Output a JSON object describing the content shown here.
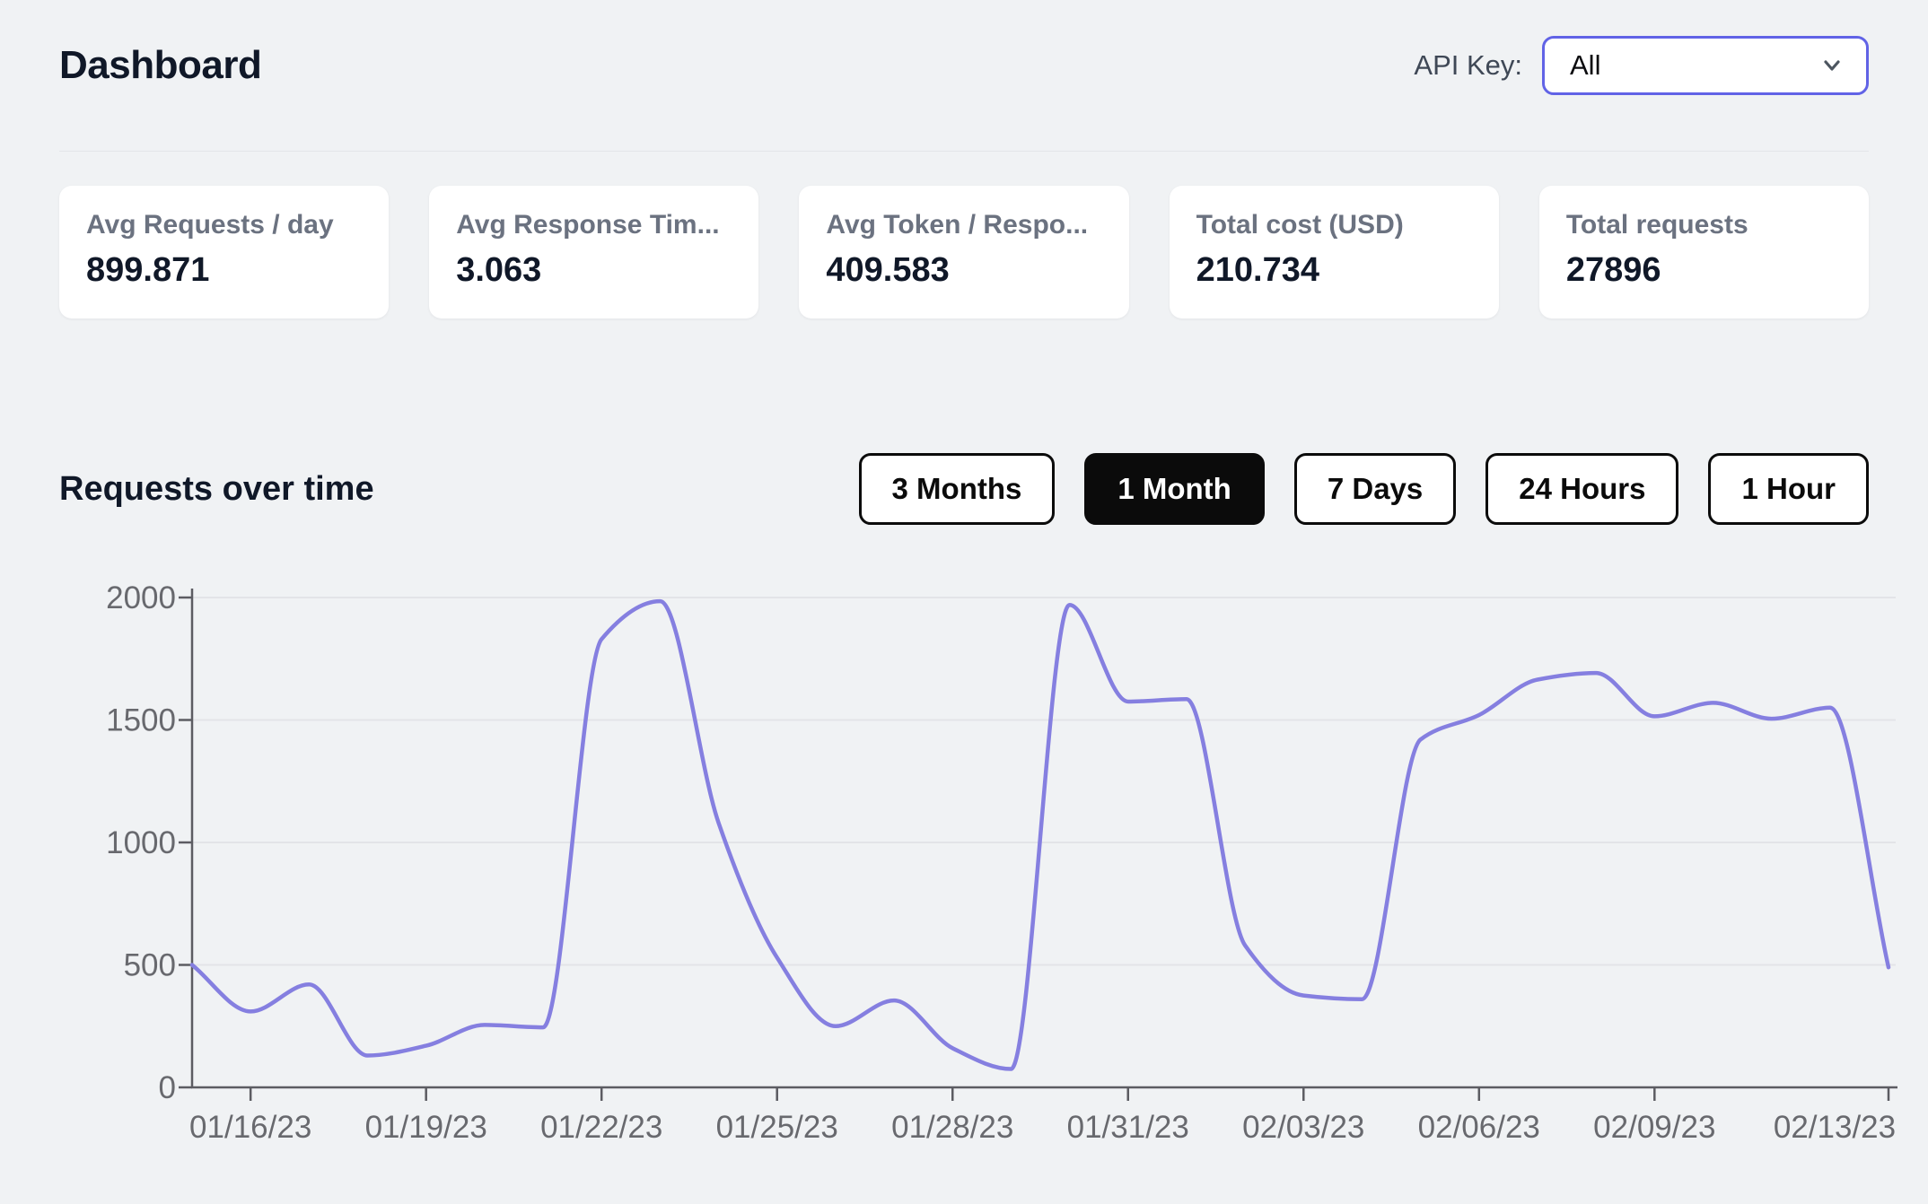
{
  "header": {
    "title": "Dashboard",
    "api_key_label": "API Key:",
    "api_key_value": "All"
  },
  "stats": [
    {
      "label": "Avg Requests / day",
      "value": "899.871"
    },
    {
      "label": "Avg Response Tim...",
      "value": "3.063"
    },
    {
      "label": "Avg Token / Respo...",
      "value": "409.583"
    },
    {
      "label": "Total cost (USD)",
      "value": "210.734"
    },
    {
      "label": "Total requests",
      "value": "27896"
    }
  ],
  "section": {
    "title": "Requests over time"
  },
  "range_buttons": [
    {
      "label": "3 Months",
      "active": false
    },
    {
      "label": "1 Month",
      "active": true
    },
    {
      "label": "7 Days",
      "active": false
    },
    {
      "label": "24 Hours",
      "active": false
    },
    {
      "label": "1 Hour",
      "active": false
    }
  ],
  "chart_data": {
    "type": "line",
    "title": "Requests over time",
    "xlabel": "",
    "ylabel": "",
    "x": [
      "01/15/23",
      "01/16/23",
      "01/17/23",
      "01/18/23",
      "01/19/23",
      "01/20/23",
      "01/21/23",
      "01/22/23",
      "01/23/23",
      "01/24/23",
      "01/25/23",
      "01/26/23",
      "01/27/23",
      "01/28/23",
      "01/29/23",
      "01/30/23",
      "01/31/23",
      "02/01/23",
      "02/02/23",
      "02/03/23",
      "02/04/23",
      "02/05/23",
      "02/06/23",
      "02/07/23",
      "02/08/23",
      "02/09/23",
      "02/10/23",
      "02/11/23",
      "02/12/23",
      "02/13/23"
    ],
    "values": [
      500,
      310,
      420,
      130,
      170,
      255,
      245,
      1830,
      1985,
      1080,
      530,
      250,
      355,
      160,
      75,
      1970,
      1575,
      1585,
      580,
      375,
      360,
      1420,
      1520,
      1665,
      1692,
      1515,
      1570,
      1505,
      1550,
      490
    ],
    "x_tick_indices": [
      1,
      4,
      7,
      10,
      13,
      16,
      19,
      22,
      25,
      29
    ],
    "x_tick_labels": [
      "01/16/23",
      "01/19/23",
      "01/22/23",
      "01/25/23",
      "01/28/23",
      "01/31/23",
      "02/03/23",
      "02/06/23",
      "02/09/23",
      "02/13/23"
    ],
    "y_ticks": [
      0,
      500,
      1000,
      1500,
      2000
    ],
    "ylim": [
      0,
      2000
    ],
    "grid": true,
    "legend": false,
    "line_color": "#857fe0",
    "curve": "monotone"
  },
  "colors": {
    "accent": "#6163e6",
    "line": "#857fe0",
    "grid": "#e3e4e8",
    "axis": "#5c5c62",
    "tick_text": "#68696e",
    "active_button_bg": "#0b0b0b",
    "background": "#f0f2f4",
    "card_bg": "#ffffff"
  }
}
